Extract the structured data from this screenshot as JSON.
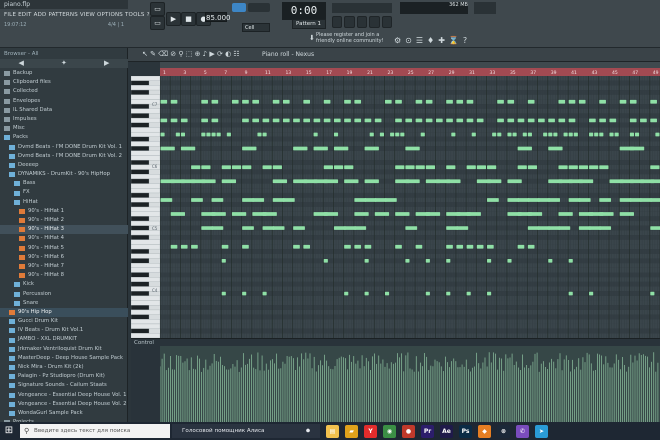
{
  "window": {
    "title": "piano.flp"
  },
  "menu": [
    "FILE",
    "EDIT",
    "ADD",
    "PATTERNS",
    "VIEW",
    "OPTIONS",
    "TOOLS",
    "?"
  ],
  "hint": {
    "left": "19:07:12",
    "right": "4/4 | 1"
  },
  "transport": {
    "tempo": "85.000",
    "time": "0:00",
    "time_sub": "00",
    "pattern": "Pattern 1",
    "mode": "Cell"
  },
  "status": {
    "memory": "362 MB"
  },
  "notice": {
    "line1": "Please register and join a",
    "line2": "friendly online community!"
  },
  "browser": {
    "header": "Browser - All",
    "items": [
      {
        "label": "Backup",
        "type": "folder",
        "level": 0
      },
      {
        "label": "Clipboard files",
        "type": "folder",
        "level": 0
      },
      {
        "label": "Collected",
        "type": "folder",
        "level": 0
      },
      {
        "label": "Envelopes",
        "type": "folder",
        "level": 0
      },
      {
        "label": "IL Shared Data",
        "type": "folder",
        "level": 0
      },
      {
        "label": "Impulses",
        "type": "folder",
        "level": 0
      },
      {
        "label": "Misc",
        "type": "folder",
        "level": 0
      },
      {
        "label": "Packs",
        "type": "pack-root",
        "level": 0
      },
      {
        "label": "Dvmd Beats - I'M DONE Drum Kit Vol. 1",
        "type": "pack",
        "level": 1
      },
      {
        "label": "Dvmd Beats - I'M DONE Drum Kit Vol. 2",
        "type": "pack",
        "level": 1
      },
      {
        "label": "Deeeep",
        "type": "pack",
        "level": 1
      },
      {
        "label": "DYNAMIKS - DrumKit - 90's HipHop",
        "type": "pack-open",
        "level": 1
      },
      {
        "label": "Bass",
        "type": "pack",
        "level": 2
      },
      {
        "label": "FX",
        "type": "pack",
        "level": 2
      },
      {
        "label": "HiHat",
        "type": "pack-open",
        "level": 2
      },
      {
        "label": "90's - HiHat 1",
        "type": "sample",
        "level": 3
      },
      {
        "label": "90's - HiHat 2",
        "type": "sample",
        "level": 3
      },
      {
        "label": "90's - HiHat 3",
        "type": "sample-sel",
        "level": 3
      },
      {
        "label": "90's - HiHat 4",
        "type": "sample",
        "level": 3
      },
      {
        "label": "90's - HiHat 5",
        "type": "sample",
        "level": 3
      },
      {
        "label": "90's - HiHat 6",
        "type": "sample",
        "level": 3
      },
      {
        "label": "90's - HiHat 7",
        "type": "sample",
        "level": 3
      },
      {
        "label": "90's - HiHat 8",
        "type": "sample",
        "level": 3
      },
      {
        "label": "Kick",
        "type": "pack",
        "level": 2
      },
      {
        "label": "Percussion",
        "type": "pack",
        "level": 2
      },
      {
        "label": "Snare",
        "type": "pack",
        "level": 2
      },
      {
        "label": "90's Hip Hop",
        "type": "sample-hi",
        "level": 1
      },
      {
        "label": "Gucci Drum Kit",
        "type": "pack",
        "level": 1
      },
      {
        "label": "IV Beats - Drum Kit Vol.1",
        "type": "pack",
        "level": 1
      },
      {
        "label": "JAMBO - XXL DRUMKIT",
        "type": "pack",
        "level": 1
      },
      {
        "label": "Jrkmaker Ventriloquist Drum Kit",
        "type": "pack",
        "level": 1
      },
      {
        "label": "MasterDeep - Deep House Sample Pack",
        "type": "pack",
        "level": 1
      },
      {
        "label": "Nick Mira - Drum Kit (2k)",
        "type": "pack",
        "level": 1
      },
      {
        "label": "Paiagin - Pz Studiopro (Drum Kit)",
        "type": "pack",
        "level": 1
      },
      {
        "label": "Signature Sounds - Cailum Staats",
        "type": "pack",
        "level": 1
      },
      {
        "label": "Vengeance - Essential Deep House Vol. 1",
        "type": "pack",
        "level": 1
      },
      {
        "label": "Vengeance - Essential Deep House Vol. 2",
        "type": "pack",
        "level": 1
      },
      {
        "label": "WondaGurl Sample Pack",
        "type": "pack",
        "level": 1
      },
      {
        "label": "Projects",
        "type": "folder",
        "level": 0
      }
    ]
  },
  "piano_roll": {
    "title": "Piano roll - Nexus",
    "control_label": "Control",
    "ruler_marks": [
      "1",
      "3",
      "5",
      "7",
      "9",
      "11",
      "13",
      "15",
      "17",
      "19",
      "21",
      "23",
      "25",
      "27",
      "29",
      "31",
      "33",
      "35",
      "37",
      "39",
      "41",
      "43",
      "45",
      "47",
      "49"
    ],
    "octave_labels": [
      "C7",
      "C6",
      "C5",
      "C4"
    ],
    "note_color": "#8fe0a6",
    "ruler_color": "#a24a52"
  },
  "taskbar": {
    "search_placeholder": "Введите здесь текст для поиска",
    "assistant": "Голосовой помощник Алиса",
    "apps": [
      {
        "name": "file-explorer-icon",
        "glyph": "▤",
        "color": "#f2c14e"
      },
      {
        "name": "explorer-icon",
        "glyph": "▰",
        "color": "#e0a21b"
      },
      {
        "name": "yandex-icon",
        "glyph": "Y",
        "color": "#e22c2c"
      },
      {
        "name": "chrome-icon",
        "glyph": "◉",
        "color": "#3b8f45"
      },
      {
        "name": "media-icon",
        "glyph": "●",
        "color": "#c0392b"
      },
      {
        "name": "premiere-icon",
        "glyph": "Pr",
        "color": "#2c1d6b"
      },
      {
        "name": "after-effects-icon",
        "glyph": "Ae",
        "color": "#1f1a4a"
      },
      {
        "name": "photoshop-icon",
        "glyph": "Ps",
        "color": "#0b2b45"
      },
      {
        "name": "fl-studio-icon",
        "glyph": "◆",
        "color": "#e67e22"
      },
      {
        "name": "steam-icon",
        "glyph": "⊛",
        "color": "#1b2838"
      },
      {
        "name": "viber-icon",
        "glyph": "✆",
        "color": "#7a4cbd"
      },
      {
        "name": "telegram-icon",
        "glyph": "➤",
        "color": "#2a9bd6"
      }
    ]
  }
}
